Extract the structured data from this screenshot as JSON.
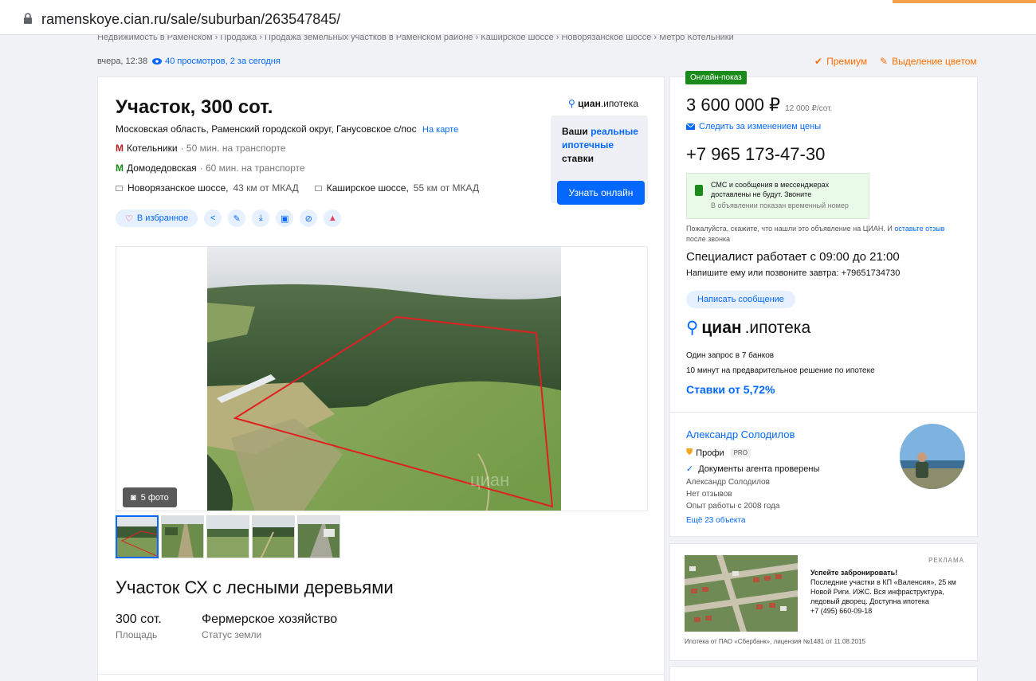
{
  "browser": {
    "url": "ramenskoye.cian.ru/sale/suburban/263547845/"
  },
  "breadcrumbs": "Недвижимость в Раменском  ›  Продажа  ›  Продажа земельных участков в Раменском районе  ›  Каширское шоссе  ›  Новорязанское шоссе  ›  Метро Котельники",
  "meta": {
    "date": "вчера, 12:38",
    "views": "40 просмотров, 2 за сегодня"
  },
  "promo": {
    "premium": "Премиум",
    "highlight": "Выделение цветом"
  },
  "listing": {
    "title": "Участок, 300 сот.",
    "address": "Московская область, Раменский городской округ, Ганусовское с/пос",
    "map_link": "На карте",
    "metro": [
      {
        "station": "Котельники",
        "time": " · 50 мин. на транспорте",
        "color": "#b5222a"
      },
      {
        "station": "Домодедовская",
        "time": " · 60 мин. на транспорте",
        "color": "#1a8a1a"
      }
    ],
    "highways": [
      {
        "name": "Новорязанское шоссе,",
        "dist": "43 км от МКАД"
      },
      {
        "name": "Каширское шоссе,",
        "dist": "55 км от МКАД"
      }
    ],
    "favorite": "В избранное",
    "photo_count": "5 фото",
    "watermark": "циан",
    "subtitle": "Участок СХ с лесными деревьями",
    "features": [
      {
        "value": "300 сот.",
        "label": "Площадь"
      },
      {
        "value": "Фермерское хозяйство",
        "label": "Статус земли"
      }
    ]
  },
  "mortgage_widget": {
    "logo_bold": "циан",
    "logo_light": ".ипотека",
    "t1": "Ваши ",
    "t2": "реальные ипотечные",
    "t3": " ставки",
    "button": "Узнать онлайн"
  },
  "sidebar": {
    "online_badge": "Онлайн-показ",
    "price": "3 600 000 ₽",
    "price_per": "12 000 ₽/сот.",
    "follow": "Следить за изменением цены",
    "phone": "+7 965 173-47-30",
    "sms_a": "СМС и сообщения в мессенджерах доставлены не будут. Звоните",
    "sms_b": "В объявлении показан временный номер",
    "ask_1": "Пожалуйста, скажите, что нашли это объявление на ЦИАН. И ",
    "ask_link": "оставьте отзыв",
    "ask_2": " после звонка",
    "spec": "Специалист работает с 09:00 до 21:00",
    "write": "Напишите ему или позвоните завтра: +79651734730",
    "msg_button": "Написать сообщение",
    "mort_bold": "циан",
    "mort_light": ".ипотека",
    "mort_line1": "Один запрос в 7 банков",
    "mort_line2": "10 минут на предварительное решение по ипотеке",
    "rates": "Ставки от 5,72%"
  },
  "agent": {
    "name": "Александр Солодилов",
    "profi": "Профи",
    "pro": "PRO",
    "docs": "Документы агента проверены",
    "line1": "Александр Солодилов",
    "line2": "Нет отзывов",
    "line3": "Опыт работы с 2008 года",
    "more": "Ещё 23 объекта"
  },
  "ad": {
    "label": "РЕКЛАМА",
    "headline": "Успейте забронировать!",
    "body": "Последние участки в КП «Валенсия», 25 км Новой Риги. ИЖС. Вся инфраструктура, ледовый дворец. Доступна ипотека",
    "phone": "+7 (495) 660-09-18",
    "foot": "Ипотека от ПАО «Сбербанк», лицензия №1481 от 11.08.2015"
  }
}
